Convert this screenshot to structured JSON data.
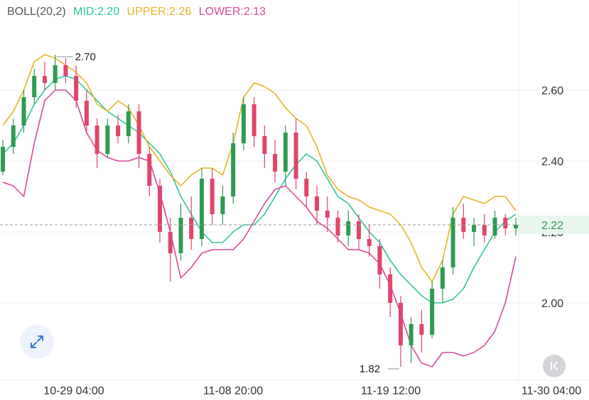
{
  "indicator": {
    "name": "BOLL(20,2)",
    "mid_label": "MID:2.20",
    "upper_label": "UPPER:2.26",
    "lower_label": "LOWER:2.13"
  },
  "colors": {
    "header_text": "#555555",
    "mid": "#2ec4a0",
    "upper": "#e6b422",
    "lower": "#d9489a",
    "up_candle": "#2f9a52",
    "down_candle": "#e0456c",
    "grid": "#eeeeee",
    "price_tag_bg": "#e8f6ee",
    "price_tag_text": "#2f9a52"
  },
  "icons": {
    "expand": "expand-arrows-icon",
    "back": "collapse-panel-icon"
  },
  "chart_data": {
    "type": "candlestick",
    "yticks": [
      "2.00",
      "2.20",
      "2.40",
      "2.60"
    ],
    "ytick_values": [
      2.0,
      2.2,
      2.4,
      2.6
    ],
    "ylim": [
      1.78,
      2.78
    ],
    "xticks": [
      "10-29 04:00",
      "11-08 20:00",
      "11-19 12:00",
      "11-30 04:00"
    ],
    "current_price_label": "2.22",
    "current_price": 2.22,
    "high_label": "2.70",
    "high_value": 2.7,
    "low_label": "1.82",
    "low_value": 1.82,
    "series": [
      {
        "name": "MID",
        "color": "mid",
        "values": [
          2.42,
          2.45,
          2.5,
          2.56,
          2.6,
          2.63,
          2.64,
          2.63,
          2.6,
          2.57,
          2.54,
          2.52,
          2.5,
          2.48,
          2.45,
          2.42,
          2.37,
          2.3,
          2.25,
          2.2,
          2.17,
          2.17,
          2.2,
          2.22,
          2.22,
          2.25,
          2.3,
          2.35,
          2.39,
          2.42,
          2.4,
          2.35,
          2.3,
          2.28,
          2.24,
          2.2,
          2.17,
          2.12,
          2.08,
          2.05,
          2.02,
          2.0,
          2.0,
          2.01,
          2.04,
          2.1,
          2.15,
          2.2,
          2.23,
          2.25
        ]
      },
      {
        "name": "UPPER",
        "color": "upper",
        "values": [
          2.5,
          2.54,
          2.6,
          2.68,
          2.7,
          2.69,
          2.67,
          2.65,
          2.62,
          2.56,
          2.54,
          2.57,
          2.55,
          2.5,
          2.44,
          2.4,
          2.36,
          2.33,
          2.36,
          2.38,
          2.38,
          2.36,
          2.45,
          2.58,
          2.62,
          2.61,
          2.59,
          2.55,
          2.52,
          2.5,
          2.44,
          2.36,
          2.32,
          2.3,
          2.29,
          2.27,
          2.26,
          2.25,
          2.22,
          2.17,
          2.1,
          2.06,
          2.12,
          2.25,
          2.3,
          2.29,
          2.28,
          2.3,
          2.3,
          2.26
        ]
      },
      {
        "name": "LOWER",
        "color": "lower",
        "values": [
          2.34,
          2.33,
          2.3,
          2.45,
          2.57,
          2.6,
          2.6,
          2.57,
          2.48,
          2.43,
          2.41,
          2.4,
          2.4,
          2.41,
          2.4,
          2.31,
          2.2,
          2.07,
          2.1,
          2.14,
          2.15,
          2.15,
          2.15,
          2.18,
          2.23,
          2.28,
          2.32,
          2.33,
          2.3,
          2.27,
          2.23,
          2.21,
          2.18,
          2.15,
          2.15,
          2.14,
          2.11,
          2.05,
          1.97,
          1.88,
          1.83,
          1.82,
          1.86,
          1.86,
          1.85,
          1.86,
          1.88,
          1.92,
          2.0,
          2.13
        ]
      }
    ],
    "candles": [
      {
        "o": 2.37,
        "h": 2.46,
        "l": 2.36,
        "c": 2.44
      },
      {
        "o": 2.44,
        "h": 2.52,
        "l": 2.42,
        "c": 2.5
      },
      {
        "o": 2.5,
        "h": 2.6,
        "l": 2.48,
        "c": 2.58
      },
      {
        "o": 2.58,
        "h": 2.66,
        "l": 2.56,
        "c": 2.64
      },
      {
        "o": 2.64,
        "h": 2.68,
        "l": 2.6,
        "c": 2.62
      },
      {
        "o": 2.62,
        "h": 2.7,
        "l": 2.6,
        "c": 2.67
      },
      {
        "o": 2.67,
        "h": 2.69,
        "l": 2.62,
        "c": 2.64
      },
      {
        "o": 2.64,
        "h": 2.67,
        "l": 2.55,
        "c": 2.57
      },
      {
        "o": 2.57,
        "h": 2.6,
        "l": 2.48,
        "c": 2.5
      },
      {
        "o": 2.5,
        "h": 2.52,
        "l": 2.38,
        "c": 2.42
      },
      {
        "o": 2.42,
        "h": 2.52,
        "l": 2.41,
        "c": 2.5
      },
      {
        "o": 2.5,
        "h": 2.53,
        "l": 2.45,
        "c": 2.47
      },
      {
        "o": 2.47,
        "h": 2.56,
        "l": 2.45,
        "c": 2.54
      },
      {
        "o": 2.54,
        "h": 2.56,
        "l": 2.38,
        "c": 2.42
      },
      {
        "o": 2.42,
        "h": 2.44,
        "l": 2.3,
        "c": 2.33
      },
      {
        "o": 2.33,
        "h": 2.35,
        "l": 2.17,
        "c": 2.2
      },
      {
        "o": 2.2,
        "h": 2.24,
        "l": 2.06,
        "c": 2.14
      },
      {
        "o": 2.14,
        "h": 2.28,
        "l": 2.12,
        "c": 2.24
      },
      {
        "o": 2.24,
        "h": 2.3,
        "l": 2.15,
        "c": 2.18
      },
      {
        "o": 2.18,
        "h": 2.38,
        "l": 2.16,
        "c": 2.35
      },
      {
        "o": 2.35,
        "h": 2.38,
        "l": 2.22,
        "c": 2.25
      },
      {
        "o": 2.25,
        "h": 2.33,
        "l": 2.22,
        "c": 2.3
      },
      {
        "o": 2.3,
        "h": 2.48,
        "l": 2.28,
        "c": 2.45
      },
      {
        "o": 2.45,
        "h": 2.58,
        "l": 2.43,
        "c": 2.56
      },
      {
        "o": 2.56,
        "h": 2.58,
        "l": 2.44,
        "c": 2.47
      },
      {
        "o": 2.47,
        "h": 2.5,
        "l": 2.38,
        "c": 2.42
      },
      {
        "o": 2.42,
        "h": 2.46,
        "l": 2.34,
        "c": 2.37
      },
      {
        "o": 2.37,
        "h": 2.5,
        "l": 2.33,
        "c": 2.48
      },
      {
        "o": 2.48,
        "h": 2.52,
        "l": 2.32,
        "c": 2.35
      },
      {
        "o": 2.35,
        "h": 2.37,
        "l": 2.27,
        "c": 2.3
      },
      {
        "o": 2.3,
        "h": 2.33,
        "l": 2.22,
        "c": 2.26
      },
      {
        "o": 2.26,
        "h": 2.3,
        "l": 2.2,
        "c": 2.24
      },
      {
        "o": 2.24,
        "h": 2.26,
        "l": 2.17,
        "c": 2.19
      },
      {
        "o": 2.19,
        "h": 2.26,
        "l": 2.16,
        "c": 2.23
      },
      {
        "o": 2.23,
        "h": 2.25,
        "l": 2.15,
        "c": 2.18
      },
      {
        "o": 2.18,
        "h": 2.22,
        "l": 2.13,
        "c": 2.16
      },
      {
        "o": 2.16,
        "h": 2.18,
        "l": 2.04,
        "c": 2.08
      },
      {
        "o": 2.08,
        "h": 2.1,
        "l": 1.96,
        "c": 2.0
      },
      {
        "o": 2.0,
        "h": 2.02,
        "l": 1.82,
        "c": 1.88
      },
      {
        "o": 1.88,
        "h": 1.96,
        "l": 1.83,
        "c": 1.94
      },
      {
        "o": 1.94,
        "h": 1.98,
        "l": 1.86,
        "c": 1.91
      },
      {
        "o": 1.91,
        "h": 2.06,
        "l": 1.9,
        "c": 2.04
      },
      {
        "o": 2.04,
        "h": 2.12,
        "l": 2.0,
        "c": 2.1
      },
      {
        "o": 2.1,
        "h": 2.27,
        "l": 2.08,
        "c": 2.24
      },
      {
        "o": 2.24,
        "h": 2.28,
        "l": 2.18,
        "c": 2.2
      },
      {
        "o": 2.2,
        "h": 2.24,
        "l": 2.16,
        "c": 2.22
      },
      {
        "o": 2.22,
        "h": 2.25,
        "l": 2.17,
        "c": 2.19
      },
      {
        "o": 2.19,
        "h": 2.26,
        "l": 2.18,
        "c": 2.24
      },
      {
        "o": 2.24,
        "h": 2.25,
        "l": 2.19,
        "c": 2.21
      },
      {
        "o": 2.21,
        "h": 2.24,
        "l": 2.19,
        "c": 2.22
      }
    ]
  }
}
